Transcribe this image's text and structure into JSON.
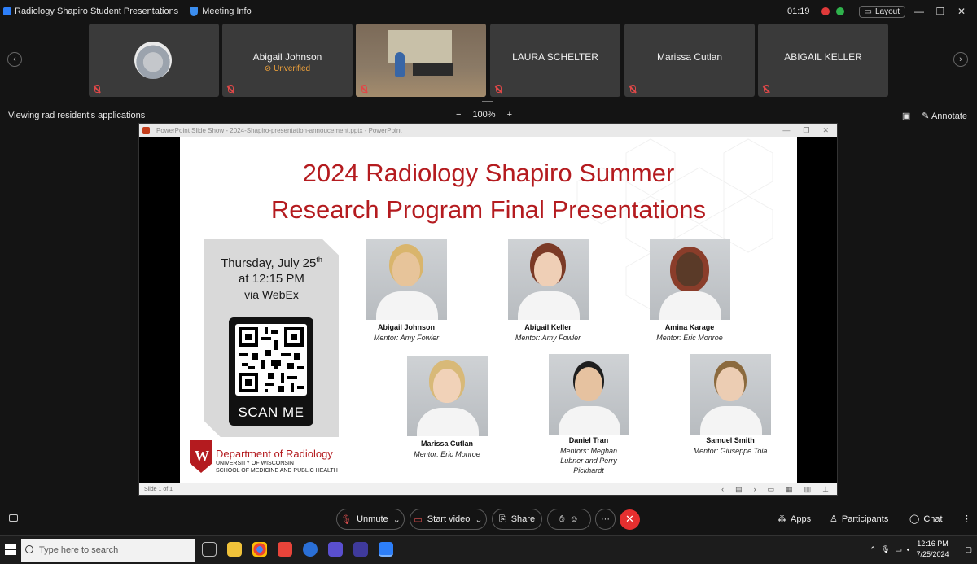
{
  "window": {
    "app_title": "Radiology Shapiro Student Presentations",
    "meeting_info": "Meeting Info",
    "timer": "01:19",
    "layout_label": "Layout"
  },
  "participants": [
    {
      "name": "",
      "status": ""
    },
    {
      "name": "Abigail Johnson",
      "status": "Unverified"
    },
    {
      "name": "",
      "status": ""
    },
    {
      "name": "LAURA SCHELTER",
      "status": ""
    },
    {
      "name": "Marissa Cutlan",
      "status": ""
    },
    {
      "name": "ABIGAIL KELLER",
      "status": ""
    }
  ],
  "share": {
    "viewing_text": "Viewing rad resident's applications",
    "zoom_minus": "−",
    "zoom_level": "100%",
    "zoom_plus": "+",
    "annotate_label": "Annotate"
  },
  "ppt": {
    "window_title": "PowerPoint Slide Show  -  2024-Shapiro-presentation-annoucement.pptx  -  PowerPoint",
    "status": "Slide 1 of 1"
  },
  "slide": {
    "title_line1": "2024 Radiology Shapiro Summer",
    "title_line2": "Research Program Final Presentations",
    "date_line": "Thursday, July 25",
    "date_sup": "th",
    "time_line": "at 12:15 PM",
    "via_line": "via WebEx",
    "scan_me": "SCAN ME",
    "dept_name": "Department of Radiology",
    "dept_sub1": "UNIVERSITY OF WISCONSIN",
    "dept_sub2": "SCHOOL OF MEDICINE AND PUBLIC HEALTH",
    "presenters": [
      {
        "name": "Abigail Johnson",
        "mentor": "Mentor: Amy Fowler"
      },
      {
        "name": "Abigail Keller",
        "mentor": "Mentor: Amy Fowler"
      },
      {
        "name": "Amina Karage",
        "mentor": "Mentor: Eric Monroe"
      },
      {
        "name": "Marissa Cutlan",
        "mentor": "Mentor: Eric Monroe"
      },
      {
        "name": "Daniel Tran",
        "mentor": "Mentors: Meghan Lubner and Perry Pickhardt"
      },
      {
        "name": "Samuel Smith",
        "mentor": "Mentor: Giuseppe Toia"
      }
    ]
  },
  "controls": {
    "unmute": "Unmute",
    "start_video": "Start video",
    "share": "Share",
    "apps": "Apps",
    "participants": "Participants",
    "chat": "Chat",
    "more": "···",
    "end": "✕"
  },
  "taskbar": {
    "search_placeholder": "Type here to search",
    "time": "12:16 PM",
    "date": "7/25/2024"
  },
  "colors": {
    "accent_red": "#b41b1f",
    "end_call": "#e52f2f",
    "unverified": "#f2a33a"
  }
}
